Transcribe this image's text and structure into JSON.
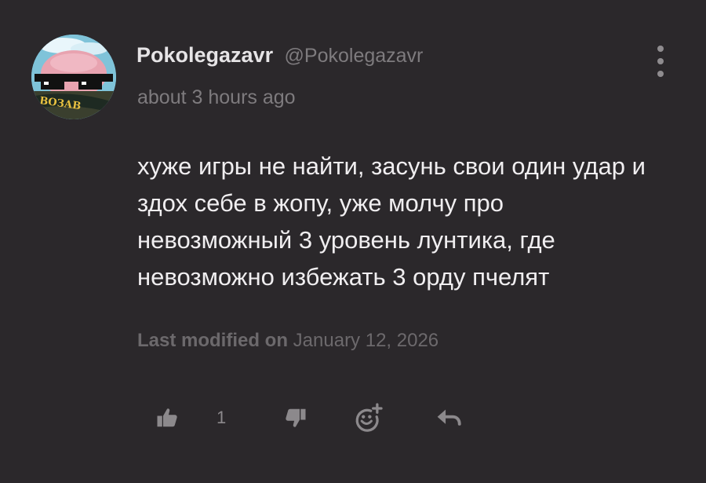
{
  "author": {
    "display_name": "Pokolegazavr",
    "handle": "@Pokolegazavr",
    "avatar_caption": "ВОЗАВ"
  },
  "posted": "about 3 hours ago",
  "body": "хуже игры не найти, засунь свои один удар и здох себе в жопу, уже молчу про невозможный 3 уровень лунтика, где невозможно избежать 3 орду пчелят",
  "last_modified": {
    "label": "Last modified on",
    "date": "January 12, 2026"
  },
  "actions": {
    "like_count": "1",
    "icons": [
      "thumbs-up-icon",
      "thumbs-down-icon",
      "add-reaction-icon",
      "reply-icon",
      "more-options-icon"
    ]
  },
  "colors": {
    "background": "#2b282b",
    "text": "#f0eef0",
    "muted": "#7e7b7e"
  }
}
